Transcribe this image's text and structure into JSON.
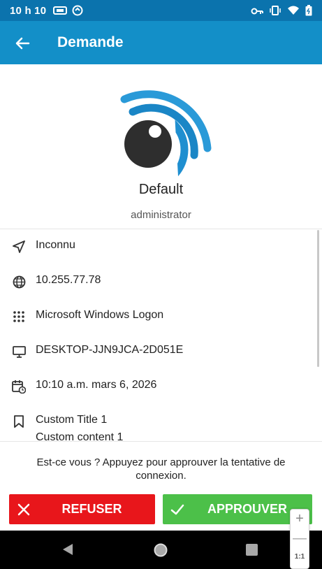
{
  "status_bar": {
    "time": "10 h 10",
    "icons": [
      "cast-icon",
      "sync-icon",
      "vpn-key-icon",
      "vibrate-icon",
      "wifi-icon",
      "battery-icon"
    ]
  },
  "app_bar": {
    "title": "Demande",
    "color": "#138fc8"
  },
  "profile": {
    "name": "Default",
    "username": "administrator"
  },
  "details": [
    {
      "icon": "location-arrow-icon",
      "text": "Inconnu"
    },
    {
      "icon": "globe-icon",
      "text": "10.255.77.78"
    },
    {
      "icon": "apps-grid-icon",
      "text": "Microsoft Windows Logon"
    },
    {
      "icon": "monitor-icon",
      "text": "DESKTOP-JJN9JCA-2D051E"
    },
    {
      "icon": "calendar-clock-icon",
      "text": "10:10 a.m. mars 6, 2026"
    },
    {
      "icon": "bookmark-icon",
      "text": "Custom Title 1",
      "subtext": "Custom content 1"
    }
  ],
  "footer": {
    "prompt": "Est-ce vous ? Appuyez pour approuver la tentative de connexion.",
    "refuse_label": "REFUSER",
    "approve_label": "APPROUVER",
    "refuse_color": "#e8161b",
    "approve_color": "#4cc049"
  },
  "zoom": {
    "plus": "+",
    "minus": "—",
    "level": "1:1"
  }
}
